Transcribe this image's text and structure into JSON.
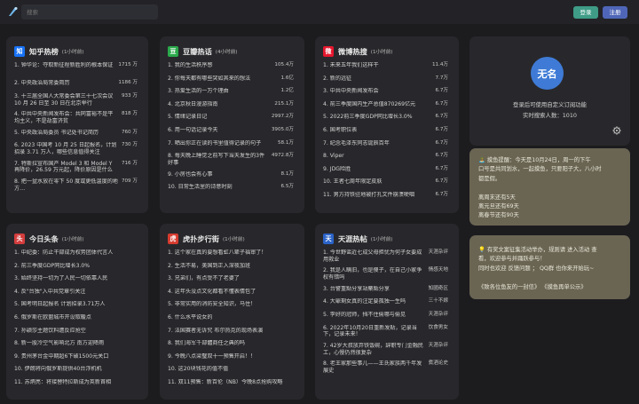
{
  "search": {
    "placeholder": "搜索"
  },
  "auth": {
    "login": "登录",
    "register": "注册"
  },
  "cards": [
    {
      "name": "zhihu",
      "title": "知乎热榜",
      "sub": "(1小时前)",
      "icon_text": "知",
      "icon_color": "#1772f6",
      "items": [
        {
          "title": "钟华论：夺取新征程新胜利的根本保证",
          "hot": "1715 万",
          "tall": true
        },
        {
          "title": "中央政治局常委简历",
          "hot": "1186 万"
        },
        {
          "title": "十三届全国人大常委会第三十七次会议 10 月 26 日至 30 日在北京举行",
          "hot": "933 万",
          "tall": true
        },
        {
          "title": "中共中央新闻发布会：共同富裕不是平均主义，不是劫富济贫",
          "hot": "818 万",
          "tall": true
        },
        {
          "title": "中央政治局委员 书记处书记简历",
          "hot": "760 万"
        },
        {
          "title": "2023 中国考 10 月 25 日起报名，计划招录 3.71 万人，哪些信息值得关注",
          "hot": "730 万",
          "tall": true
        },
        {
          "title": "特斯拉宣布国产 Model 3 和 Model Y 再降价，26.59 万元起，降价原因是什么",
          "hot": "716 万",
          "tall": true
        },
        {
          "title": "把一盆水放在零下 50 度或更低温度的地方…",
          "hot": "709 万"
        }
      ]
    },
    {
      "name": "douban",
      "title": "豆瓣热话",
      "sub": "(4小时前)",
      "icon_text": "豆",
      "icon_color": "#2aa94b",
      "items": [
        {
          "title": "我的生活秩序感",
          "hot": "105.4万"
        },
        {
          "title": "你每天都有哪些突如其来的想法",
          "hot": "1.6亿"
        },
        {
          "title": "热爱生活的一万个理由",
          "hot": "1.2亿"
        },
        {
          "title": "北京秋日漫游指南",
          "hot": "215.1万"
        },
        {
          "title": "情绪记录日记",
          "hot": "2997.2万"
        },
        {
          "title": "用一句话记录今天",
          "hot": "3905.0万"
        },
        {
          "title": "晒出你正在读的书里值得记录的句子",
          "hot": "58.1万"
        },
        {
          "title": "每天晚上睡觉之前写下当天发生的3件好事",
          "hot": "4972.8万",
          "tall": true
        },
        {
          "title": "小房也会有心事",
          "hot": "8.1万"
        },
        {
          "title": "日常生活里的诗意时刻",
          "hot": "6.5万"
        }
      ]
    },
    {
      "name": "weibo",
      "title": "微博热搜",
      "sub": "(1小时前)",
      "icon_text": "微",
      "icon_color": "#e6162d",
      "items": [
        {
          "title": "未来五年我们这样干",
          "hot": "11.4万"
        },
        {
          "title": "新的远征",
          "hot": "7.7万"
        },
        {
          "title": "中共中央新闻发布会",
          "hot": "6.7万"
        },
        {
          "title": "前三季度国内生产总值870269亿元",
          "hot": "6.7万"
        },
        {
          "title": "2022前三季度GDP同比增长3.0%",
          "hot": "6.7万"
        },
        {
          "title": "国考职位表",
          "hot": "6.7万"
        },
        {
          "title": "纪念毛泽东同志诞辰百年",
          "hot": "6.7万"
        },
        {
          "title": "Viper",
          "hot": "6.7万"
        },
        {
          "title": "JDG险胜",
          "hot": "6.7万"
        },
        {
          "title": "王者七周年限定皮肤",
          "hot": "6.7万"
        },
        {
          "title": "男方持铁驻地被打孔文件崩溃哽咽",
          "hot": "6.7万"
        }
      ]
    },
    {
      "name": "toutiao",
      "title": "今日头条",
      "sub": "(1小时前)",
      "icon_text": "头",
      "icon_color": "#d43d3d",
      "items": [
        {
          "title": "中纪委：防止干部成为权势团体代言人",
          "hot": ""
        },
        {
          "title": "前三季度GDP同比增长3.0%",
          "hot": ""
        },
        {
          "title": "始终坚持一切为了人民一切依靠人民",
          "hot": ""
        },
        {
          "title": "反\"台独\"入中共党章引关注",
          "hot": ""
        },
        {
          "title": "国考明日起报名 计划招录3.71万人",
          "hot": ""
        },
        {
          "title": "俄罗斯在欧盟城市开设取暖点",
          "hot": ""
        },
        {
          "title": "孙颖莎主题饮料遭反应抢空",
          "hot": ""
        },
        {
          "title": "新一股冷空气影响北方 南方迎降雨",
          "hot": ""
        },
        {
          "title": "贵州茅台金中期超6下破1500元关口",
          "hot": ""
        },
        {
          "title": "伊朗将向俄罗斯提供40台浮机机",
          "hot": ""
        },
        {
          "title": "苏炳亮：将接替特拉斯成为英新首相",
          "hot": ""
        }
      ]
    },
    {
      "name": "hupu",
      "title": "虎扑步行街",
      "sub": "(1小时前)",
      "icon_text": "虎",
      "icon_color": "#d63b2f",
      "items": [
        {
          "title": "这个家在真的要想看虹八辈子福审了！",
          "hot": ""
        },
        {
          "title": "生活不易，美国到正入深夜加班",
          "hot": ""
        },
        {
          "title": "兄弟们，有点受不了老婆了",
          "hot": ""
        },
        {
          "title": "这年头没点文化都看不懂表情包了",
          "hot": ""
        },
        {
          "title": "非常实用的消防安全知识，马住！",
          "hot": ""
        },
        {
          "title": "什么水平说女的",
          "hot": ""
        },
        {
          "title": "法国赛者无诉究 布尔热克的现场表演",
          "hot": ""
        },
        {
          "title": "我们海军千部體商任之典的吗",
          "hot": ""
        },
        {
          "title": "今晚八点梁璧双十一预售开启！！",
          "hot": ""
        },
        {
          "title": "这20块钱花的值不值",
          "hot": ""
        },
        {
          "title": "双11预售：新百伦（NB）今晚8点抢购攻略",
          "hot": ""
        }
      ]
    },
    {
      "name": "tianya",
      "title": "天涯热帖",
      "sub": "(1小时前)",
      "icon_text": "天",
      "icon_color": "#2b63c9",
      "items": [
        {
          "title": "今世野谣近七成父母担忧为何子女要成用救业",
          "hot": "天涯杂评",
          "tall": true
        },
        {
          "title": "我是人瞒旧，也是傻子，在自己小家争权有错吗",
          "hot": "情感天地",
          "tall": true
        },
        {
          "title": "台警重點分享站藥點分享",
          "hot": "知國奇区"
        },
        {
          "title": "大爺剩女真的注定要孤独一生吗",
          "hot": "三十不嫁"
        },
        {
          "title": "李好的冠师，挡不住偷哪与偷见",
          "hot": "天涯杂评"
        },
        {
          "title": "2022年10月20日重新发贴，记录当下，记录未来！",
          "hot": "饮食男女",
          "tall": true
        },
        {
          "title": "42岁大叔放弃铁饭碗，辞职专门金融民工，心慢仍然很复杂",
          "hot": "天涯杂评",
          "tall": true
        },
        {
          "title": "老王家那些事儿——王氏家族两千年发展史",
          "hot": "煮酒论史",
          "tall": true
        }
      ]
    }
  ],
  "profile": {
    "avatar": "无名",
    "line1": "登录后可使用自定义订阅功能",
    "line2": "实时搜索人数：1010"
  },
  "notice1": {
    "lines": [
      "🏝️ 摸鱼提醒：今天是10月24日，周一的下午",
      "口号是共同划水，一起摸鱼，只要阳子大，八小时",
      "都是假。",
      "",
      "离周末还有5天",
      "离元旦还有69天",
      "离春节还有90天"
    ]
  },
  "notice2": {
    "lines": [
      "💡 有奖文案征集活动举办，规则请 进入活动 查",
      "看，欢迎参与并踊跃参与！",
      "同时也欢迎 反馈问题 ； QQ群 也你来开始玩~",
      "",
      "《致各位鱼友的一封信》     《摸鱼再单公示》"
    ]
  }
}
